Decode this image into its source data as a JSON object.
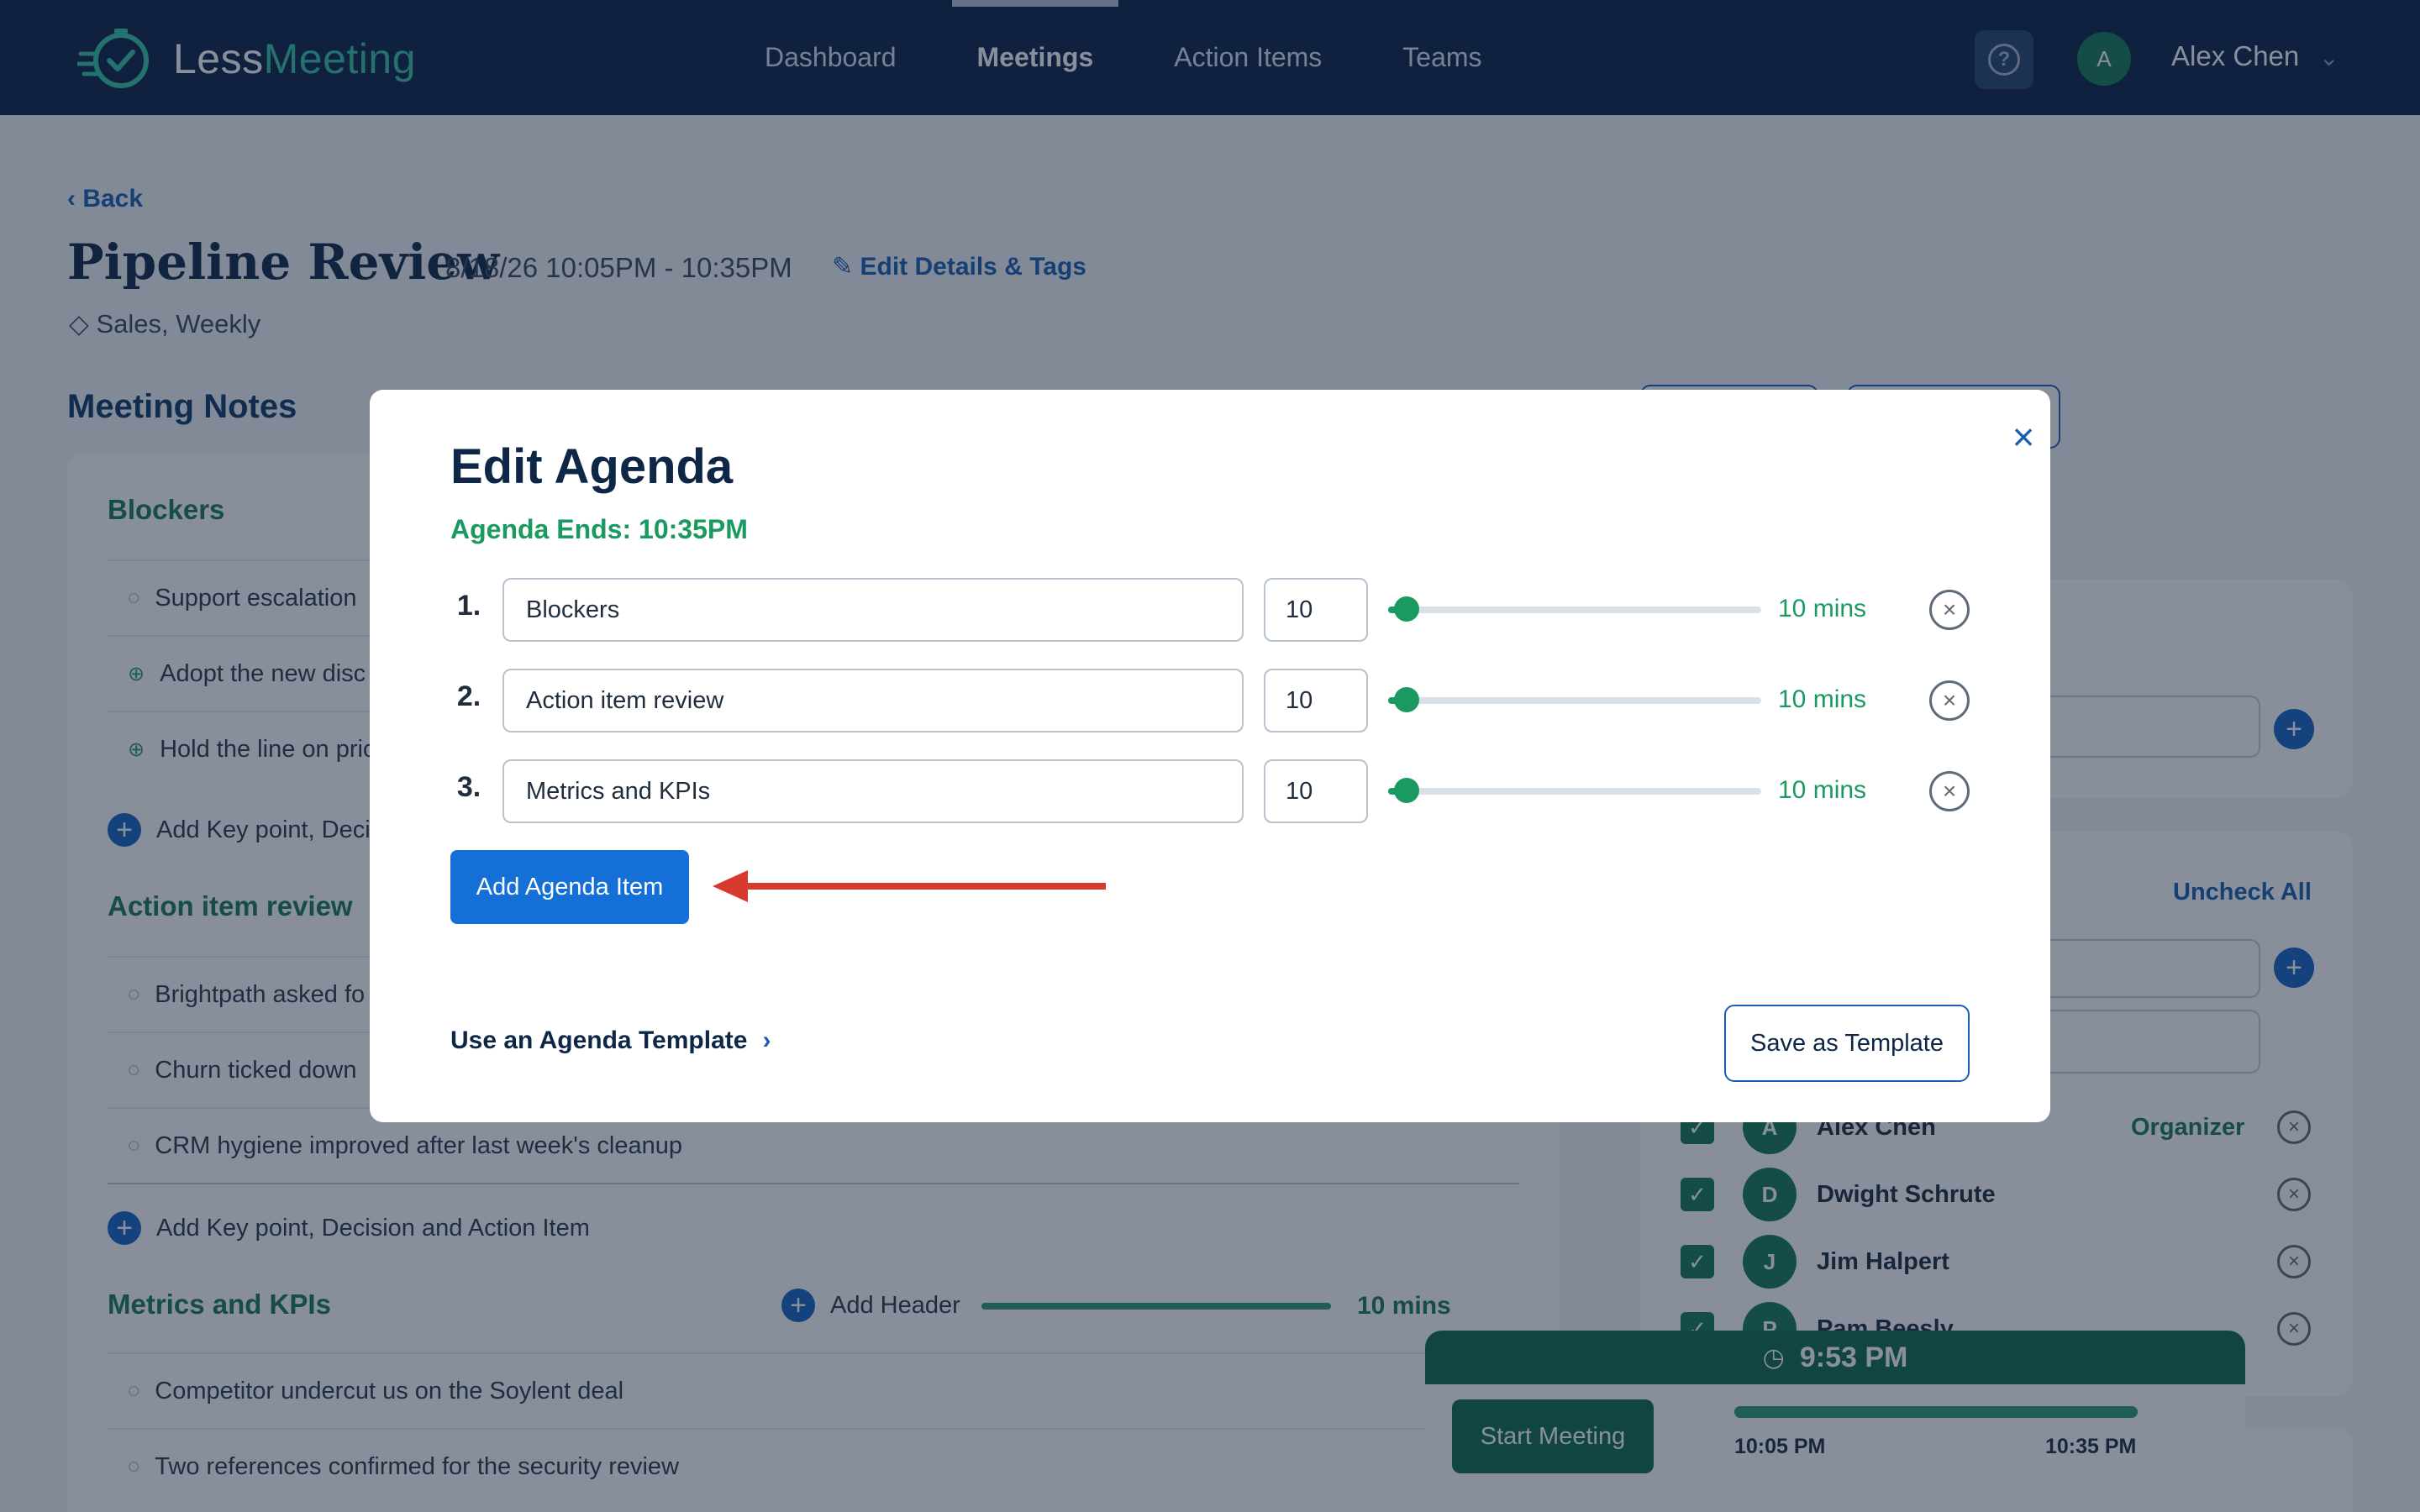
{
  "app": {
    "logo_part1": "Less",
    "logo_part2": "Meeting"
  },
  "nav": {
    "items": [
      "Dashboard",
      "Meetings",
      "Action Items",
      "Teams"
    ],
    "active": "Meetings",
    "help_label": "?",
    "user_initial": "A",
    "user_name": "Alex Chen",
    "chevron": "⌄"
  },
  "page": {
    "back_label": "Back",
    "title": "Pipeline Review",
    "dates": "8/18/26 10:05PM - 10:35PM",
    "edit_details_label": "Edit Details & Tags",
    "tags": "Sales, Weekly",
    "notes_title": "Meeting Notes"
  },
  "notes": {
    "sections": [
      {
        "title": "Blockers",
        "items": [
          "Support escalation",
          "Adopt the new disc",
          "Hold the line on pric"
        ],
        "add_label": "Add Key point, Decis"
      },
      {
        "title": "Action item review",
        "items": [
          "Brightpath asked fo",
          "Churn ticked down",
          "CRM hygiene improved after last week's cleanup"
        ],
        "add_label": "Add Key point, Decision and Action Item"
      },
      {
        "title": "Metrics and KPIs",
        "items": [
          "Competitor undercut us on the Soylent deal",
          "Two references confirmed for the security review"
        ],
        "add_header_label": "Add Header",
        "mins": "10 mins"
      }
    ]
  },
  "attendees": {
    "uncheck_all_label": "Uncheck All",
    "people": [
      {
        "initial": "A",
        "name": "Alex Chen",
        "role": "Organizer"
      },
      {
        "initial": "D",
        "name": "Dwight Schrute",
        "role": ""
      },
      {
        "initial": "J",
        "name": "Jim Halpert",
        "role": ""
      },
      {
        "initial": "P",
        "name": "Pam Beesly",
        "role": ""
      }
    ]
  },
  "timer": {
    "current_time": "9:53 PM",
    "start_label": "Start Meeting",
    "start_time": "10:05 PM",
    "end_time": "10:35 PM"
  },
  "modal": {
    "title": "Edit Agenda",
    "agenda_ends": "Agenda Ends: 10:35PM",
    "close_icon": "×",
    "items": [
      {
        "number": "1.",
        "name": "Blockers",
        "duration": "10",
        "mins_label": "10 mins",
        "slider_fraction": 0.05
      },
      {
        "number": "2.",
        "name": "Action item review",
        "duration": "10",
        "mins_label": "10 mins",
        "slider_fraction": 0.05
      },
      {
        "number": "3.",
        "name": "Metrics and KPIs",
        "duration": "10",
        "mins_label": "10 mins",
        "slider_fraction": 0.05
      }
    ],
    "add_item_label": "Add Agenda Item",
    "use_template_label": "Use an Agenda Template",
    "save_template_label": "Save as Template"
  },
  "colors": {
    "nav_bg": "#0c2346",
    "brand_green": "#1a9a60",
    "primary_blue": "#1470d6",
    "annotation_arrow": "#d63a2e"
  }
}
